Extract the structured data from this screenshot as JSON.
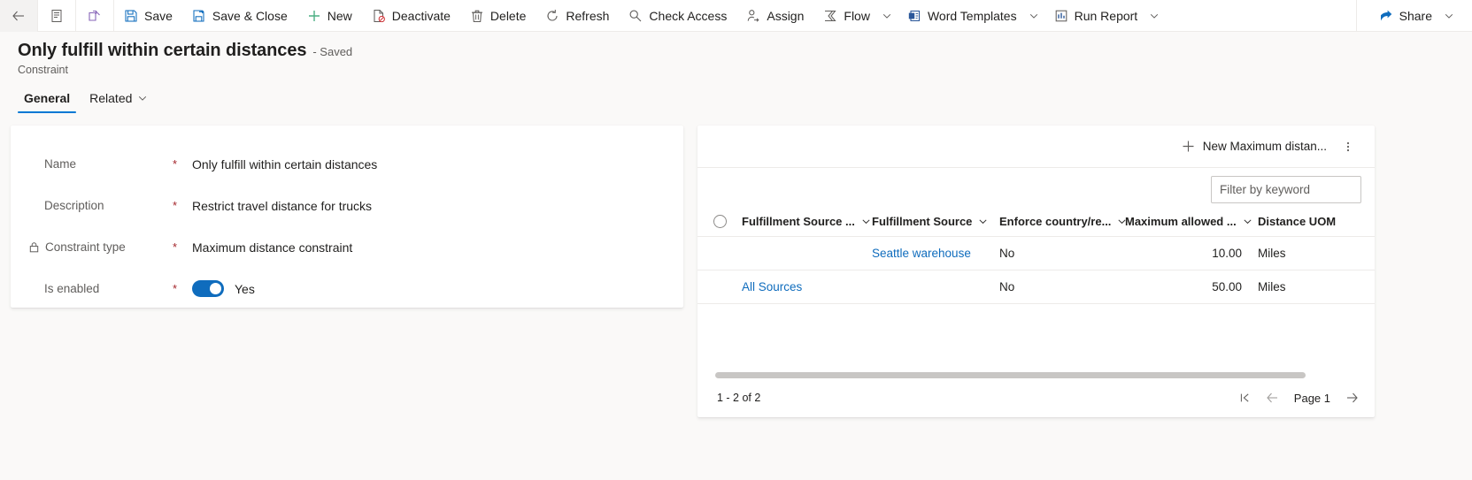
{
  "commandbar": {
    "back": {
      "icon": "back-arrow-icon",
      "label": ""
    },
    "form_selector": {
      "icon": "form-list-icon",
      "label": ""
    },
    "popout": {
      "icon": "pop-out-icon",
      "label": ""
    },
    "buttons": [
      {
        "label": "Save",
        "icon": "save-icon"
      },
      {
        "label": "Save & Close",
        "icon": "save-close-icon"
      },
      {
        "label": "New",
        "icon": "plus-icon"
      },
      {
        "label": "Deactivate",
        "icon": "deactivate-icon"
      },
      {
        "label": "Delete",
        "icon": "trash-icon"
      },
      {
        "label": "Refresh",
        "icon": "refresh-icon"
      },
      {
        "label": "Check Access",
        "icon": "key-icon"
      },
      {
        "label": "Assign",
        "icon": "person-assign-icon"
      },
      {
        "label": "Flow",
        "icon": "flow-icon",
        "caret": true
      },
      {
        "label": "Word Templates",
        "icon": "word-template-icon",
        "caret": true
      },
      {
        "label": "Run Report",
        "icon": "report-icon",
        "caret": true
      }
    ],
    "share": {
      "label": "Share",
      "icon": "share-icon",
      "caret": true
    }
  },
  "header": {
    "title": "Only fulfill within certain distances",
    "saved_status": "- Saved",
    "entity": "Constraint",
    "tabs": [
      {
        "label": "General",
        "active": true,
        "caret": false
      },
      {
        "label": "Related",
        "active": false,
        "caret": true
      }
    ]
  },
  "form": {
    "fields": [
      {
        "label": "Name",
        "required": "*",
        "value": "Only fulfill within certain distances",
        "locked": false
      },
      {
        "label": "Description",
        "required": "*",
        "value": "Restrict travel distance for trucks",
        "locked": false
      },
      {
        "label": "Constraint type",
        "required": "*",
        "value": "Maximum distance constraint",
        "locked": true
      },
      {
        "label": "Is enabled",
        "required": "*",
        "value": "Yes",
        "locked": false,
        "toggle": true
      }
    ]
  },
  "grid": {
    "new_button_label": "New Maximum distan...",
    "new_button_icon": "plus-icon",
    "overflow_icon": "more-vertical-icon",
    "filter_placeholder": "Filter by keyword",
    "filter_value": "",
    "select_all_icon": "radio-unchecked-icon",
    "columns": [
      {
        "label": "Fulfillment Source ...",
        "caret": true
      },
      {
        "label": "Fulfillment Source",
        "caret": true
      },
      {
        "label": "Enforce country/re...",
        "caret": true
      },
      {
        "label": "Maximum allowed ...",
        "caret": true
      },
      {
        "label": "Distance UOM",
        "caret": false
      }
    ],
    "rows": [
      {
        "source_group": "",
        "source": "Seattle warehouse",
        "enforce": "No",
        "max_allowed": "10.00",
        "uom": "Miles"
      },
      {
        "source_group": "All Sources",
        "source": "",
        "enforce": "No",
        "max_allowed": "50.00",
        "uom": "Miles"
      }
    ],
    "footer": {
      "count": "1 - 2 of 2",
      "page_label": "Page 1",
      "first_icon": "first-page-icon",
      "prev_icon": "prev-page-icon",
      "next_icon": "next-page-icon"
    }
  },
  "colors": {
    "accent": "#0f6cbd",
    "link": "#0f6cbd",
    "required": "#a4262c",
    "toggle_on": "#0f6cbd"
  }
}
